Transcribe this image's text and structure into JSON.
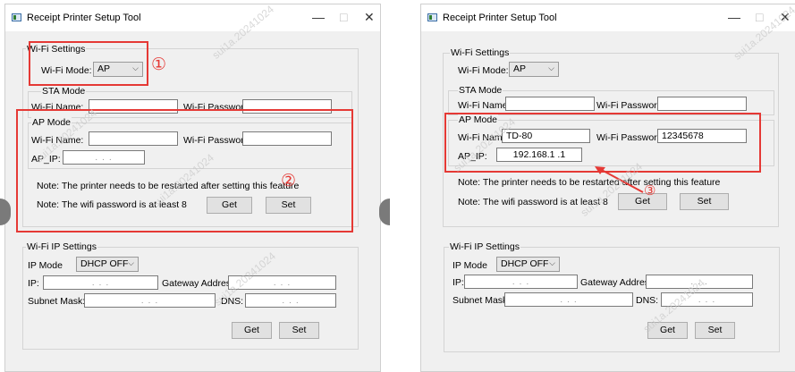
{
  "window": {
    "title": "Receipt Printer Setup Tool",
    "minimize": "—",
    "maximize": "□",
    "close": "✕"
  },
  "wifi_settings": {
    "title": "Wi-Fi Settings",
    "mode_label": "Wi-Fi Mode:",
    "mode_value": "AP"
  },
  "sta_mode": {
    "title": "STA Mode",
    "name_label": "Wi-Fi Name:",
    "password_label": "Wi-Fi Password:",
    "name_value": "",
    "password_value": ""
  },
  "ap_mode": {
    "title": "AP Mode",
    "name_label": "Wi-Fi Name:",
    "password_label": "Wi-Fi Password:",
    "ip_label": "AP_IP:",
    "left": {
      "name_value": "",
      "password_value": "",
      "ip_value": ". . ."
    },
    "right": {
      "name_value": "TD-80",
      "password_value": "12345678",
      "ip_value": "192.168.1 .1"
    }
  },
  "notes": {
    "restart": "Note: The printer needs to be restarted after setting this feature",
    "password": "Note: The wifi password is at least 8"
  },
  "buttons": {
    "get": "Get",
    "set": "Set"
  },
  "ip_settings": {
    "title": "Wi-Fi IP Settings",
    "mode_label": "IP Mode",
    "mode_value": "DHCP OFF",
    "ip_label": "IP:",
    "gateway_label": "Gateway Address:",
    "subnet_label": "Subnet Mask:",
    "dns_label": "DNS:",
    "ip_value": ". . .",
    "gateway_value": ". . .",
    "subnet_value": ". . .",
    "dns_value": ". . ."
  },
  "annotations": {
    "one": "①",
    "two": "②",
    "three": "③"
  },
  "watermark": "sui1a.20241024",
  "colors": {
    "highlight": "#e53935",
    "window_bg": "#f0f0f0"
  },
  "icons": {
    "app": "app-icon",
    "dropdown": "chevron-down-icon"
  }
}
